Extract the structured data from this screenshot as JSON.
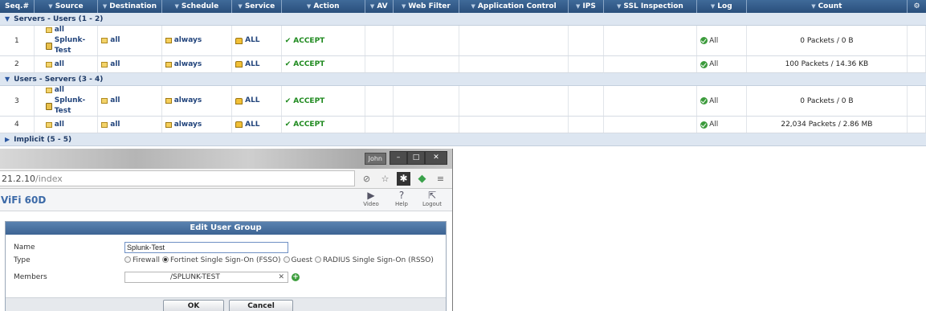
{
  "columns": [
    "Seq.#",
    "Source",
    "Destination",
    "Schedule",
    "Service",
    "Action",
    "AV",
    "Web Filter",
    "Application Control",
    "IPS",
    "SSL Inspection",
    "Log",
    "Count"
  ],
  "sections": [
    {
      "label": "Servers - Users (1 - 2)",
      "expanded": true
    },
    {
      "label": "Users - Servers (3 - 4)",
      "expanded": true
    },
    {
      "label": "Implicit (5 - 5)",
      "expanded": false
    }
  ],
  "rows": [
    {
      "seq": "1",
      "source": [
        "all",
        "Splunk-Test"
      ],
      "destination": "all",
      "schedule": "always",
      "service": "ALL",
      "action": "ACCEPT",
      "log": "All",
      "count": "0 Packets / 0 B"
    },
    {
      "seq": "2",
      "source": [
        "all"
      ],
      "destination": "all",
      "schedule": "always",
      "service": "ALL",
      "action": "ACCEPT",
      "log": "All",
      "count": "100 Packets / 14.36 KB"
    },
    {
      "seq": "3",
      "source": [
        "all",
        "Splunk-Test"
      ],
      "destination": "all",
      "schedule": "always",
      "service": "ALL",
      "action": "ACCEPT",
      "log": "All",
      "count": "0 Packets / 0 B"
    },
    {
      "seq": "4",
      "source": [
        "all"
      ],
      "destination": "all",
      "schedule": "always",
      "service": "ALL",
      "action": "ACCEPT",
      "log": "All",
      "count": "22,034 Packets / 2.86 MB"
    }
  ],
  "browser": {
    "user_chip": "John",
    "url_host": "21.2.10",
    "url_path": "/index",
    "app_name": "ViFi 60D",
    "tools": [
      {
        "label": "Video",
        "icon": "video-icon"
      },
      {
        "label": "Help",
        "icon": "help-icon"
      },
      {
        "label": "Logout",
        "icon": "logout-icon"
      }
    ]
  },
  "dialog": {
    "title": "Edit User Group",
    "name_label": "Name",
    "name_value": "Splunk-Test",
    "type_label": "Type",
    "type_options": [
      "Firewall",
      "Fortinet Single Sign-On (FSSO)",
      "Guest",
      "RADIUS Single Sign-On (RSSO)"
    ],
    "type_selected": "Fortinet Single Sign-On (FSSO)",
    "members_label": "Members",
    "members_value": "/SPLUNK-TEST",
    "ok_label": "OK",
    "cancel_label": "Cancel"
  },
  "colors": {
    "header": "#2a4f7c",
    "section": "#dde6f1",
    "accept": "#1f8a1f",
    "dialog_title": "#3d6493"
  }
}
